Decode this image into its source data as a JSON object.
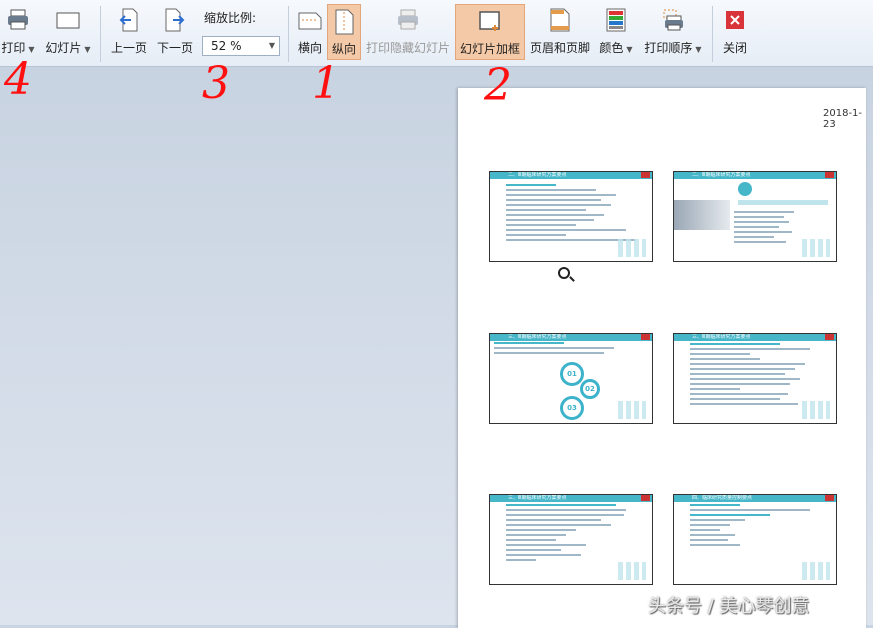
{
  "toolbar": {
    "print": "打印",
    "slides": "幻灯片",
    "prev_page": "上一页",
    "next_page": "下一页",
    "zoom_label": "缩放比例:",
    "zoom_value": "52 %",
    "landscape": "横向",
    "portrait": "纵向",
    "print_hidden": "打印隐藏幻灯片",
    "frame_slides": "幻灯片加框",
    "header_footer": "页眉和页脚",
    "color": "颜色",
    "print_order": "打印顺序",
    "close": "关闭"
  },
  "preview": {
    "date": "2018-1-23",
    "slides": [
      {
        "title": "二、Ⅲ期临床研究方案要点"
      },
      {
        "title": "二、Ⅲ期临床研究方案要点"
      },
      {
        "title": "三、Ⅲ期临床研究方案要点"
      },
      {
        "title": "三、Ⅲ期临床研究方案要点"
      },
      {
        "title": "三、Ⅲ期临床研究方案要点"
      },
      {
        "title": "四、临床研究质量控制要点"
      }
    ],
    "gears": [
      "01",
      "02",
      "03"
    ]
  },
  "annotations": [
    "4",
    "3",
    "1",
    "2"
  ],
  "watermark": "头条号 / 美心琴创意",
  "colors": {
    "accent_active": "#f4c9a7",
    "slide_header": "#46b6c9",
    "annotation": "#ff1010"
  }
}
